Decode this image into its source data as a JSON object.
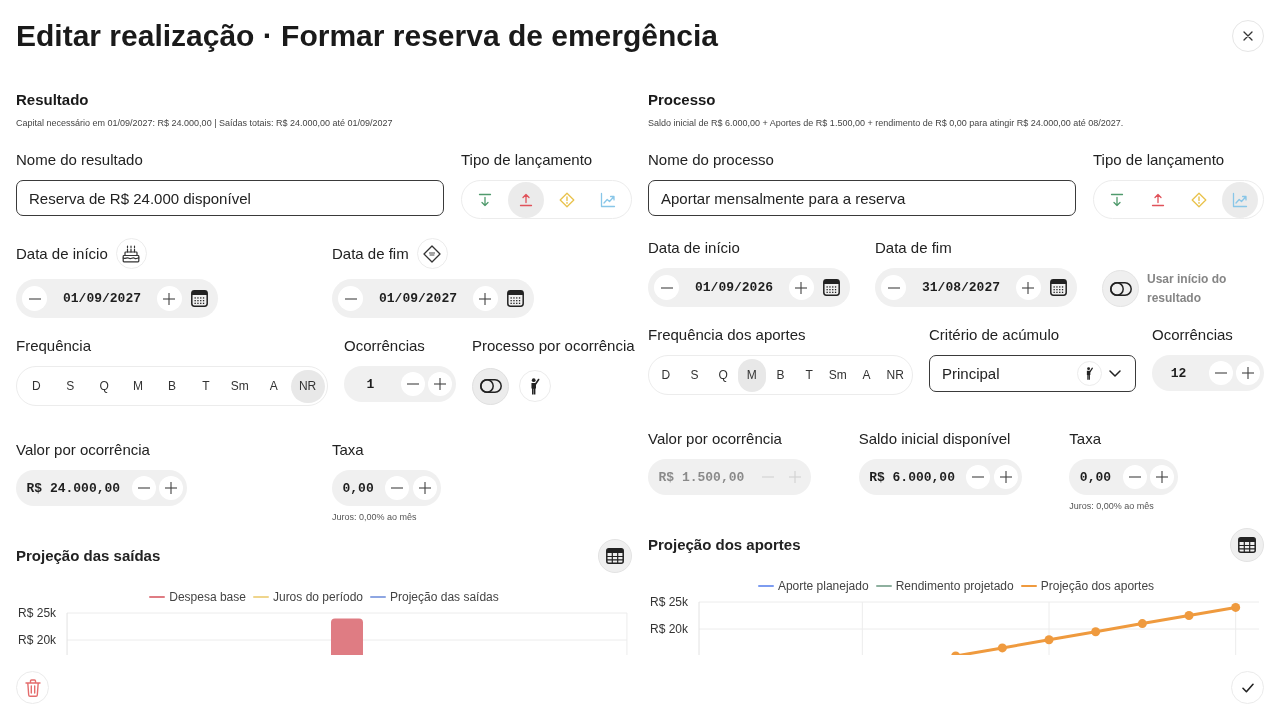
{
  "dialog": {
    "title": "Editar realização · Formar reserva de emergência"
  },
  "result": {
    "heading": "Resultado",
    "summary": "Capital necessário em 01/09/2027: R$ 24.000,00 | Saídas totais: R$ 24.000,00 até 01/09/2027",
    "name_field": {
      "label": "Nome do resultado",
      "value": "Reserva de R$ 24.000 disponível"
    },
    "entry_type": {
      "label": "Tipo de lançamento",
      "options": [
        {
          "kind": "in",
          "selected": false
        },
        {
          "kind": "out",
          "selected": true
        },
        {
          "kind": "alert",
          "selected": false
        },
        {
          "kind": "growth",
          "selected": false
        }
      ]
    },
    "start_date": {
      "label": "Data de início",
      "kind": "milestone",
      "value": "01/09/2027"
    },
    "end_date": {
      "label": "Data de fim",
      "kind": "deadline",
      "value": "01/09/2027"
    },
    "frequency": {
      "label": "Frequência",
      "options": [
        {
          "label": "D",
          "selected": false
        },
        {
          "label": "S",
          "selected": false
        },
        {
          "label": "Q",
          "selected": false
        },
        {
          "label": "M",
          "selected": false
        },
        {
          "label": "B",
          "selected": false
        },
        {
          "label": "T",
          "selected": false
        },
        {
          "label": "Sm",
          "selected": false
        },
        {
          "label": "A",
          "selected": false
        },
        {
          "label": "NR",
          "selected": true
        }
      ]
    },
    "occurrences": {
      "label": "Ocorrências",
      "value": "1",
      "disabled": false
    },
    "process_per_occurrence": {
      "label": "Processo por ocorrência",
      "options": [
        {
          "kind": "toggle",
          "selected": true
        },
        {
          "kind": "person",
          "selected": false
        }
      ]
    },
    "value_per_occurrence": {
      "label": "Valor por ocorrência",
      "value": "R$ 24.000,00",
      "disabled": false
    },
    "rate": {
      "label": "Taxa",
      "value": "0,00",
      "note": "Juros: 0,00% ao mês",
      "disabled": false
    },
    "chart": {
      "title": "Projeção das saídas",
      "kind": "bar",
      "legend": [
        {
          "label": "Despesa base",
          "color": "#df7c83"
        },
        {
          "label": "Juros do período",
          "color": "#efd58c"
        },
        {
          "label": "Projeção das saídas",
          "color": "#8ea6e2"
        }
      ],
      "y_axis_labels": [
        "R$ 25k",
        "R$ 20k"
      ]
    }
  },
  "process": {
    "heading": "Processo",
    "summary": "Saldo inicial de R$ 6.000,00 + Aportes de R$ 1.500,00 + rendimento de R$ 0,00 para atingir R$ 24.000,00 até 08/2027.",
    "name_field": {
      "label": "Nome do processo",
      "value": "Aportar mensalmente para a reserva"
    },
    "entry_type": {
      "label": "Tipo de lançamento",
      "options": [
        {
          "kind": "in",
          "selected": false
        },
        {
          "kind": "out",
          "selected": false
        },
        {
          "kind": "alert",
          "selected": false
        },
        {
          "kind": "growth",
          "selected": true
        }
      ]
    },
    "start_date": {
      "label": "Data de início",
      "value": "01/09/2026"
    },
    "end_date": {
      "label": "Data de fim",
      "value": "31/08/2027"
    },
    "use_result_start": {
      "label": "Usar início do resultado",
      "on": false
    },
    "frequency": {
      "label": "Frequência dos aportes",
      "options": [
        {
          "label": "D",
          "selected": false
        },
        {
          "label": "S",
          "selected": false
        },
        {
          "label": "Q",
          "selected": false
        },
        {
          "label": "M",
          "selected": true
        },
        {
          "label": "B",
          "selected": false
        },
        {
          "label": "T",
          "selected": false
        },
        {
          "label": "Sm",
          "selected": false
        },
        {
          "label": "A",
          "selected": false
        },
        {
          "label": "NR",
          "selected": false
        }
      ]
    },
    "accumulation": {
      "label": "Critério de acúmulo",
      "value": "Principal"
    },
    "occurrences": {
      "label": "Ocorrências",
      "value": "12",
      "disabled": false
    },
    "value_per_occurrence": {
      "label": "Valor por ocorrência",
      "value": "R$ 1.500,00",
      "disabled": true
    },
    "initial_balance": {
      "label": "Saldo inicial disponível",
      "value": "R$ 6.000,00",
      "disabled": false
    },
    "rate": {
      "label": "Taxa",
      "value": "0,00",
      "note": "Juros: 0,00% ao mês",
      "disabled": false
    },
    "chart": {
      "title": "Projeção dos aportes",
      "kind": "line",
      "legend": [
        {
          "label": "Aporte planejado",
          "color": "#7d9cf0"
        },
        {
          "label": "Rendimento projetado",
          "color": "#8eb09f"
        },
        {
          "label": "Projeção dos aportes",
          "color": "#ef9a3e"
        }
      ],
      "y_axis_labels": [
        "R$ 25k",
        "R$ 20k"
      ]
    }
  }
}
